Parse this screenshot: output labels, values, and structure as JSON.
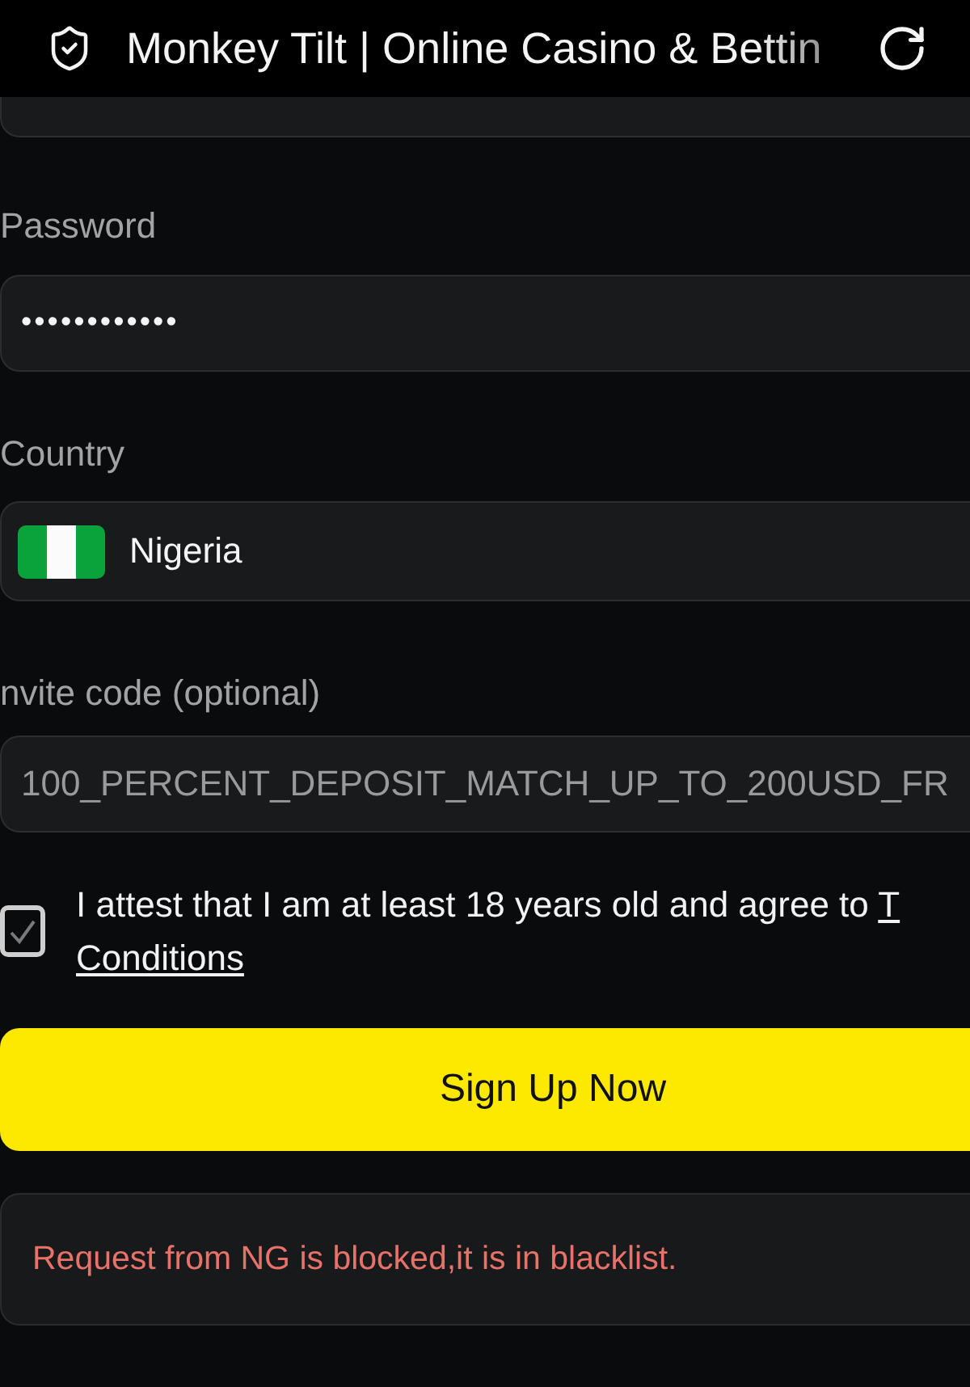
{
  "browser_bar": {
    "title": "Monkey Tilt | Online Casino & Bettin"
  },
  "fields": [
    {
      "kind": "password",
      "label": "Password",
      "value": "••••••••••••",
      "disabled": false
    },
    {
      "kind": "country",
      "label": "Country",
      "value": "Nigeria",
      "disabled": false
    },
    {
      "kind": "text",
      "label": "nvite code (optional)",
      "value": "100_PERCENT_DEPOSIT_MATCH_UP_TO_200USD_FR",
      "disabled": true
    }
  ],
  "agreement": {
    "checked": true,
    "text": "I attest that I am at least 18 years old and agree to",
    "link_start": "T",
    "link_end": "Conditions"
  },
  "submit": {
    "label": "Sign Up Now"
  },
  "error": {
    "message": "Request from NG is blocked,it is in blacklist."
  }
}
